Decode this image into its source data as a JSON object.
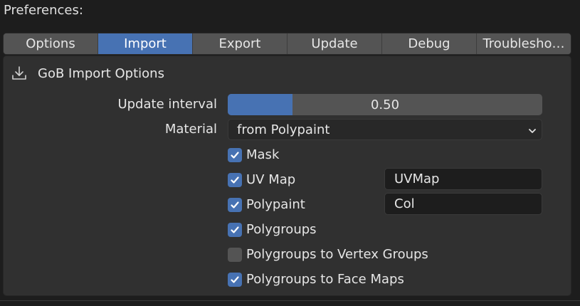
{
  "window": {
    "title": "Preferences:"
  },
  "tabs": [
    {
      "label": "Options",
      "active": false
    },
    {
      "label": "Import",
      "active": true
    },
    {
      "label": "Export",
      "active": false
    },
    {
      "label": "Update",
      "active": false
    },
    {
      "label": "Debug",
      "active": false
    },
    {
      "label": "Troublesho…",
      "active": false
    }
  ],
  "panel": {
    "icon": "import-icon",
    "title": "GoB Import Options",
    "update_interval": {
      "label": "Update interval",
      "value": "0.50",
      "fill_fraction": 0.206
    },
    "material": {
      "label": "Material",
      "value": "from Polypaint"
    },
    "options": [
      {
        "label": "Mask",
        "checked": true
      },
      {
        "label": "UV Map",
        "checked": true,
        "field_value": "UVMap"
      },
      {
        "label": "Polypaint",
        "checked": true,
        "field_value": "Col"
      },
      {
        "label": "Polygroups",
        "checked": true
      },
      {
        "label": "Polygroups to Vertex Groups",
        "checked": false
      },
      {
        "label": "Polygroups to Face Maps",
        "checked": true
      }
    ]
  },
  "colors": {
    "accent": "#4772b3",
    "panel_bg": "#303030",
    "window_bg": "#1d1d1d",
    "button_bg": "#545454"
  }
}
